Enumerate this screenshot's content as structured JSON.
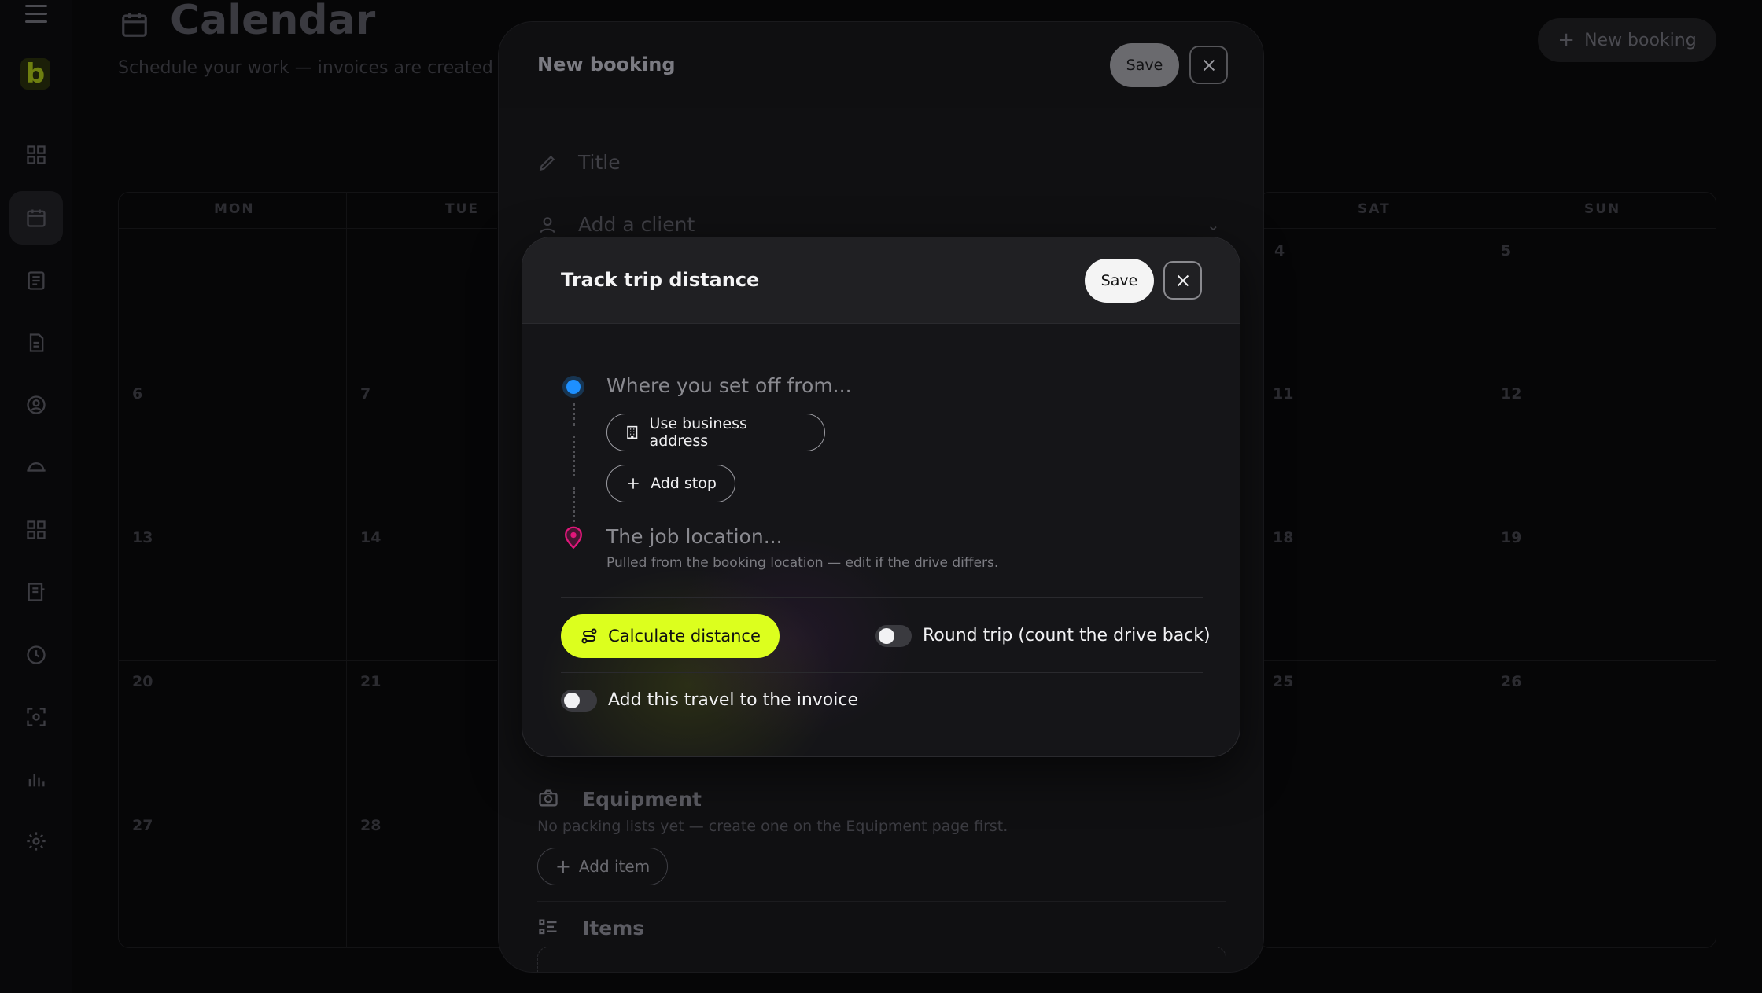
{
  "app": {
    "title": "Calendar",
    "subtitle": "Schedule your work — invoices are created a",
    "new_booking_label": "New booking",
    "logo_letter": "b"
  },
  "calendar": {
    "days": [
      "MON",
      "TUE",
      "SAT",
      "SUN"
    ],
    "dates": [
      "4",
      "5",
      "6",
      "7",
      "11",
      "12",
      "13",
      "14",
      "18",
      "19",
      "20",
      "21",
      "25",
      "26",
      "27",
      "28"
    ]
  },
  "booking": {
    "title": "New booking",
    "save_label": "Save",
    "title_placeholder": "Title",
    "client_placeholder": "Add a client",
    "equipment_title": "Equipment",
    "equipment_note": "No packing lists yet — create one on the Equipment page first.",
    "add_item_label": "Add item",
    "items_title": "Items"
  },
  "trip": {
    "title": "Track trip distance",
    "save_label": "Save",
    "from_placeholder": "Where you set off from...",
    "use_business_label": "Use business address",
    "add_stop_label": "Add stop",
    "location_placeholder": "The job location...",
    "location_help": "Pulled from the booking location — edit if the drive differs.",
    "calculate_label": "Calculate distance",
    "round_trip_label": "Round trip (count the drive back)",
    "round_trip_on": false,
    "add_invoice_label": "Add this travel to the invoice",
    "add_invoice_on": false
  },
  "colors": {
    "accent": "#dcff1e",
    "start_dot": "#1e90ff",
    "end_pin": "#e0177a"
  }
}
